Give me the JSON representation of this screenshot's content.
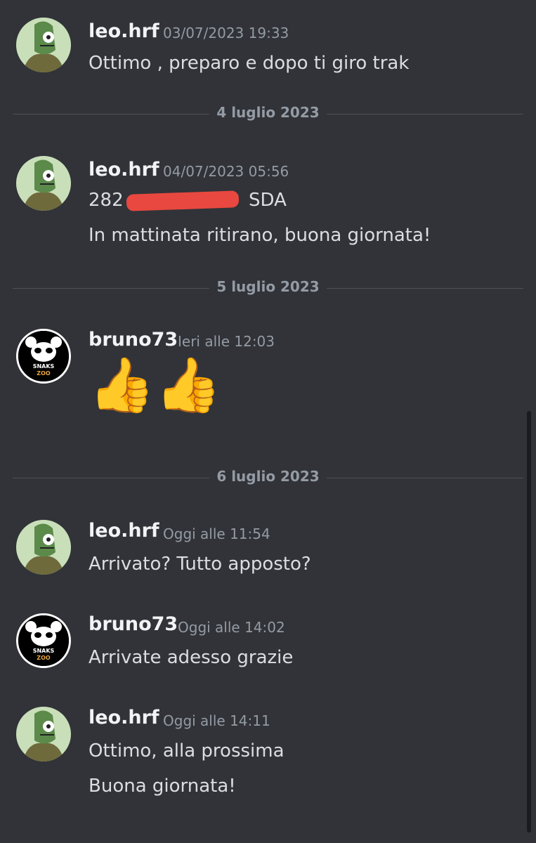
{
  "messages": [
    {
      "author": "leo.hrf",
      "timestamp": "03/07/2023 19:33",
      "lines": [
        "Ottimo , preparo e dopo ti giro trak"
      ]
    },
    {
      "author": "leo.hrf",
      "timestamp": "04/07/2023 05:56",
      "lines": [
        "282",
        "SDA",
        "In mattinata ritirano, buona giornata!"
      ]
    },
    {
      "author": "bruno73",
      "timestamp": "Ieri alle 12:03",
      "lines": [
        "👍👍"
      ]
    },
    {
      "author": "leo.hrf",
      "timestamp": "Oggi alle 11:54",
      "lines": [
        "Arrivato? Tutto apposto?"
      ]
    },
    {
      "author": "bruno73",
      "timestamp": "Oggi alle 14:02",
      "lines": [
        "Arrivate adesso grazie"
      ]
    },
    {
      "author": "leo.hrf",
      "timestamp": "Oggi alle 14:11",
      "lines": [
        "Ottimo, alla prossima",
        "Buona giornata!"
      ]
    }
  ],
  "dividers": [
    "4 luglio 2023",
    "5 luglio 2023",
    "6 luglio 2023"
  ],
  "avatar_logo_text": [
    "SNAKS",
    "ZOO"
  ],
  "colors": {
    "background": "#313338",
    "redaction": "#e8483f",
    "username": "#f2f3f5",
    "timestamp": "#949ba4"
  }
}
